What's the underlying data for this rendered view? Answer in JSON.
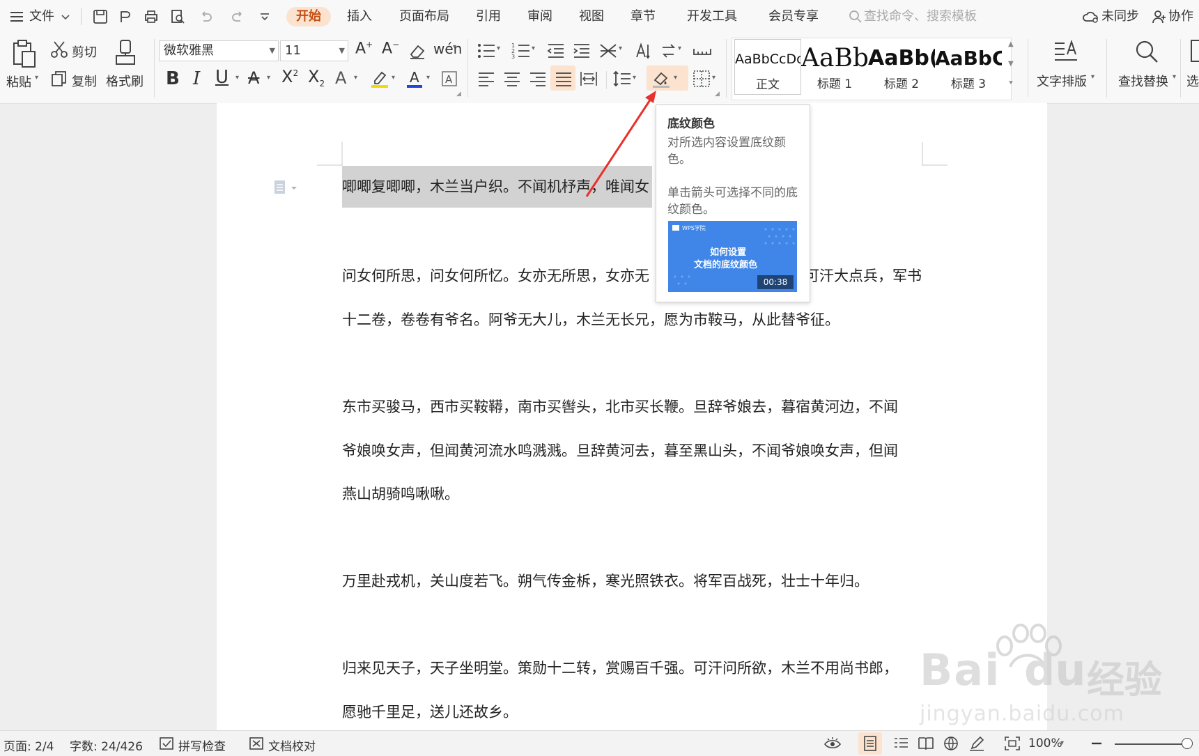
{
  "menubar": {
    "file_label": "文件",
    "tabs": [
      "开始",
      "插入",
      "页面布局",
      "引用",
      "审阅",
      "视图",
      "章节",
      "开发工具",
      "会员专享"
    ],
    "active_tab": "开始",
    "search_placeholder": "查找命令、搜索模板",
    "sync_label": "未同步",
    "collab_label": "协作"
  },
  "ribbon": {
    "paste_label": "粘贴",
    "cut_label": "剪切",
    "copy_label": "复制",
    "format_painter_label": "格式刷",
    "font_name": "微软雅黑",
    "font_size": "11",
    "styles": [
      {
        "preview": "AaBbCcDc",
        "name": "正文"
      },
      {
        "preview": "AaBb",
        "name": "标题 1"
      },
      {
        "preview": "AaBb(",
        "name": "标题 2"
      },
      {
        "preview": "AaBbC",
        "name": "标题 3"
      }
    ],
    "text_layout_label": "文字排版",
    "find_replace_label": "查找替换",
    "select_label": "选"
  },
  "tooltip": {
    "title": "底纹颜色",
    "desc1": "对所选内容设置底纹颜色。",
    "desc2": "单击箭头可选择不同的底纹颜色。",
    "video_brand": "WPS学院",
    "video_title_line1": "如何设置",
    "video_title_line2": "文档的底纹颜色",
    "video_duration": "00:38"
  },
  "document": {
    "paragraphs": [
      "唧唧复唧唧，木兰当户织。不闻机杼声，唯闻女",
      "问女何所思，问女何所忆。女亦无所思，女亦无",
      "可汗大点兵，军书",
      "十二卷，卷卷有爷名。阿爷无大儿，木兰无长兄，愿为市鞍马，从此替爷征。",
      "东市买骏马，西市买鞍鞯，南市买辔头，北市买长鞭。旦辞爷娘去，暮宿黄河边，不闻",
      "爷娘唤女声，但闻黄河流水鸣溅溅。旦辞黄河去，暮至黑山头，不闻爷娘唤女声，但闻",
      "燕山胡骑鸣啾啾。",
      "万里赴戎机，关山度若飞。朔气传金柝，寒光照铁衣。将军百战死，壮士十年归。",
      "归来见天子，天子坐明堂。策勋十二转，赏赐百千强。可汗问所欲，木兰不用尚书郎，",
      "愿驰千里足，送儿还故乡。"
    ]
  },
  "statusbar": {
    "page": "页面: 2/4",
    "word_count": "字数: 24/426",
    "spell_check": "拼写检查",
    "doc_proof": "文档校对",
    "zoom": "100%"
  },
  "watermark": {
    "brand": "Bai",
    "brand2": "du",
    "cn": "经验",
    "url": "jingyan.baidu.com"
  },
  "colors": {
    "accent_tab_bg": "#fbe3cf",
    "accent_tab_text": "#c44f12",
    "highlight_gray": "#d2d2d2",
    "arrow_red": "#e8312c",
    "video_blue": "#3f86e8"
  }
}
